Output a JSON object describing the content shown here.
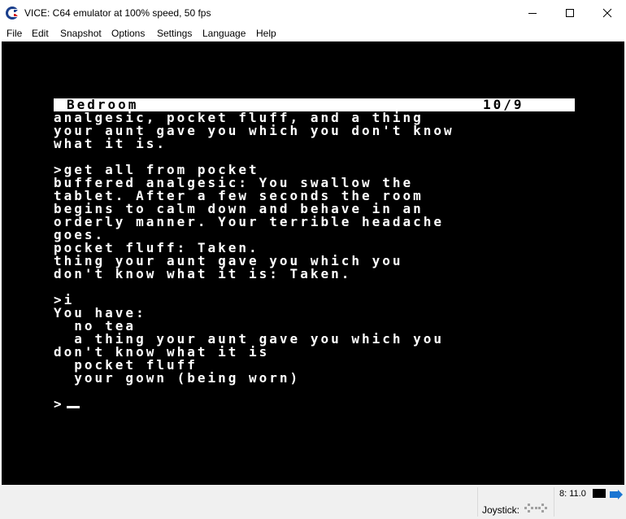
{
  "window": {
    "title": "VICE: C64 emulator at 100% speed, 50 fps"
  },
  "menu": {
    "items": [
      "File",
      "Edit",
      "Snapshot",
      "Options",
      "Settings",
      "Language",
      "Help"
    ]
  },
  "game": {
    "room": "Bedroom",
    "score": "10/9",
    "lines": [
      "analgesic, pocket fluff, and a thing",
      "your aunt gave you which you don't know",
      "what it is.",
      "",
      ">get all from pocket",
      "buffered analgesic: You swallow the",
      "tablet. After a few seconds the room",
      "begins to calm down and behave in an",
      "orderly manner. Your terrible headache",
      "goes.",
      "pocket fluff: Taken.",
      "thing your aunt gave you which you",
      "don't know what it is: Taken.",
      "",
      ">i",
      "You have:",
      "  no tea",
      "  a thing your aunt gave you which you",
      "don't know what it is",
      "  pocket fluff",
      "  your gown (being worn)",
      "",
      ">"
    ]
  },
  "statusbar": {
    "drive": "8: 11.0",
    "joystick_label": "Joystick:"
  },
  "colors": {
    "screen_background": "#000000",
    "screen_text": "#ffffff",
    "tape_indicator": "#1a75d2"
  }
}
